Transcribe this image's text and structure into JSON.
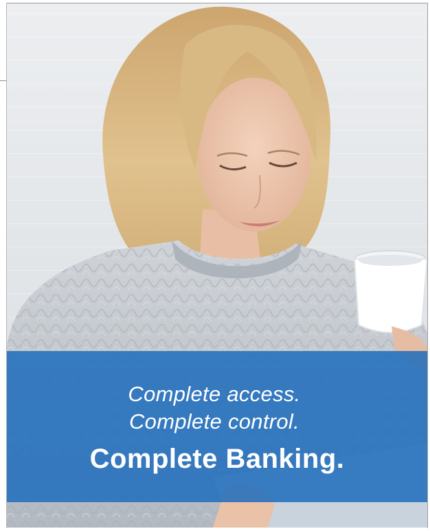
{
  "banner": {
    "line1": "Complete access.",
    "line2": "Complete control.",
    "headline": "Complete Banking."
  },
  "colors": {
    "banner_blue": "#226ebd",
    "text": "#ffffff",
    "background_wall": "#e6e9ec",
    "hair": "#d9b77a",
    "sweater": "#c4c9cf"
  },
  "photo": {
    "subject": "woman-with-coffee-cup-photo"
  }
}
